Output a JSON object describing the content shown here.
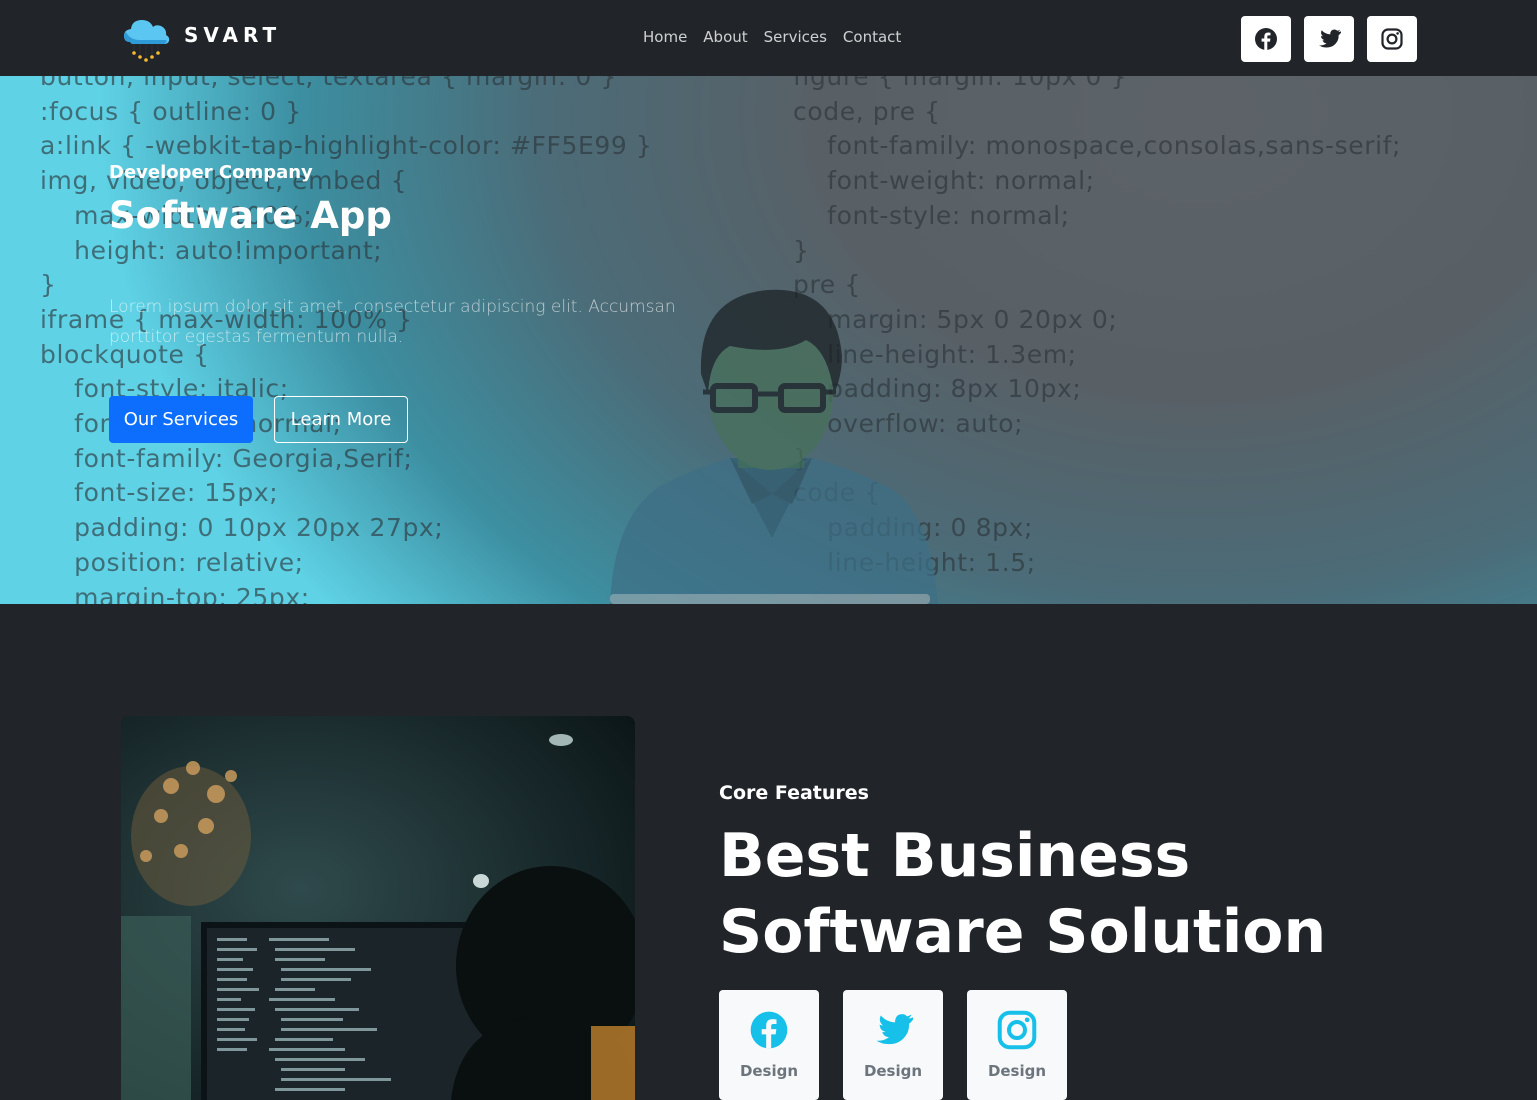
{
  "nav": {
    "brand": "SVART",
    "links": [
      "Home",
      "About",
      "Services",
      "Contact"
    ],
    "social": [
      "facebook-icon",
      "twitter-icon",
      "instagram-icon"
    ]
  },
  "hero": {
    "code_left": "button, input, select, textarea { margin: 0 }\n:focus { outline: 0 }\na:link { -webkit-tap-highlight-color: #FF5E99 }\nimg, video, object, embed {\n    max-width: 100%;\n    height: auto!important;\n}\niframe { max-width: 100% }\nblockquote {\n    font-style: italic;\n    font-weight: normal;\n    font-family: Georgia,Serif;\n    font-size: 15px;\n    padding: 0 10px 20px 27px;\n    position: relative;\n    margin-top: 25px;",
    "code_right": "figure { margin: 10px 0 }\ncode, pre {\n    font-family: monospace,consolas,sans-serif;\n    font-weight: normal;\n    font-style: normal;\n}\npre {\n    margin: 5px 0 20px 0;\n    line-height: 1.3em;\n    padding: 8px 10px;\n    overflow: auto;\n}\ncode {\n    padding: 0 8px;\n    line-height: 1.5;",
    "subtitle": "Developer Company",
    "title": "Software App",
    "text": "Lorem ipsum dolor sit amet, consectetur adipiscing elit. Accumsan porttitor egestas fermentum nulla.",
    "primary_button": "Our Services",
    "secondary_button": "Learn More"
  },
  "features": {
    "subtitle": "Core Features",
    "title": "Best Business Software Solution",
    "cards": [
      {
        "icon": "facebook-icon",
        "label": "Design"
      },
      {
        "icon": "twitter-icon",
        "label": "Design"
      },
      {
        "icon": "instagram-icon",
        "label": "Design"
      }
    ]
  },
  "colors": {
    "navbar": "#212529",
    "primary": "#0d6efd",
    "accent_icon": "#17c0e9",
    "section_bg": "#212529"
  }
}
